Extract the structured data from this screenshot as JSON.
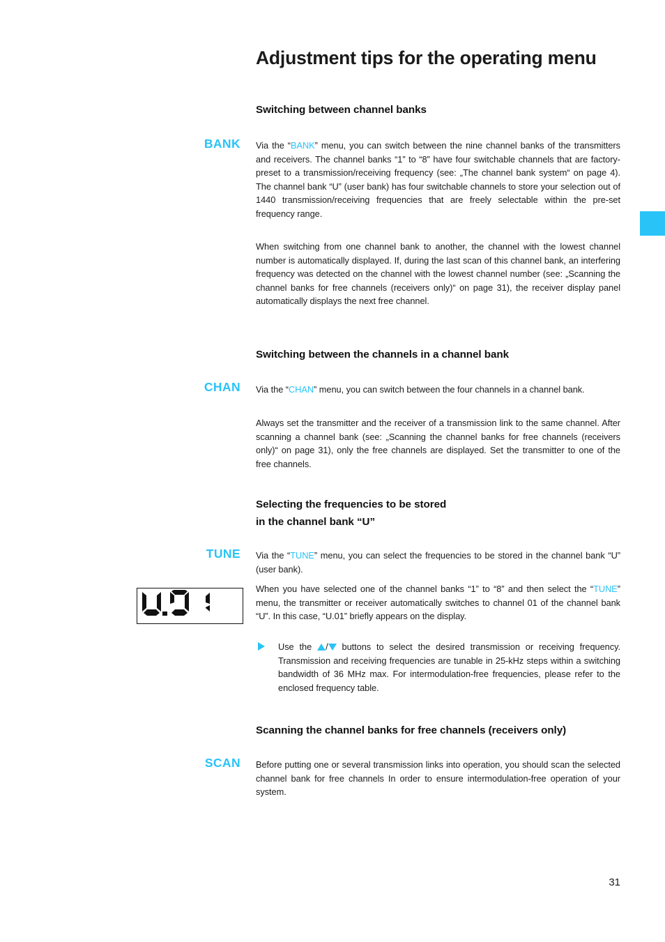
{
  "document": {
    "title": "Adjustment tips for the operating menu",
    "page_number": "31",
    "accent_color": "#29c3f7"
  },
  "chapter_tab": {
    "name": "chapter-marker",
    "color": "#29c3f7"
  },
  "sections": [
    {
      "id": "bank",
      "heading": "Switching between channel banks",
      "menu_label": "BANK",
      "paragraphs": [
        {
          "pre": "Via the “",
          "accent": "BANK",
          "post": "” menu, you can switch between the nine channel banks of the transmitters and receivers. The channel banks “1” to “8” have four switchable channels that are factory-preset to a transmission/receiving frequency (see: „The channel bank system“ on page 4). The channel bank “U” (user bank) has four switchable channels to store your selection out of 1440 transmission/receiving frequencies that are freely selectable within the pre-set frequency range."
        },
        {
          "pre": "",
          "accent": "",
          "post": "When switching from one channel bank to another, the channel with the lowest channel number is automatically displayed. If, during the last scan of this channel bank, an interfering frequency was detected on the channel with the lowest channel number (see: „Scanning the channel banks for free channels (receivers only)“ on page 31), the receiver display panel automatically displays the next free channel."
        }
      ]
    },
    {
      "id": "chan",
      "heading": "Switching between the channels in a channel bank",
      "menu_label": "CHAN",
      "paragraphs": [
        {
          "pre": "Via the “",
          "accent": "CHAN",
          "post": "” menu, you can switch between the four channels in a channel bank."
        },
        {
          "pre": "",
          "accent": "",
          "post": "Always set the transmitter and the receiver of a transmission link to the same channel. After scanning a channel bank (see: „Scanning the channel banks for free channels (receivers only)“ on page 31), only the free channels are displayed. Set the transmitter to one of the free channels."
        }
      ]
    },
    {
      "id": "tune",
      "heading_line1": "Selecting the frequencies to be stored",
      "heading_line2": "in the channel bank “U”",
      "menu_label": "TUNE",
      "paragraphs": [
        {
          "pre": "Via the “",
          "accent": "TUNE",
          "post": "” menu, you can select the frequencies to be stored in the channel bank “U” (user bank)."
        },
        {
          "pre": "When you have selected one of the channel banks “1” to “8” and then select the “",
          "accent": "TUNE",
          "post": "” menu, the transmitter or receiver automatically switches to channel 01 of the channel bank “U”. In this case, “U.01” briefly appears on the display."
        }
      ],
      "bullet": {
        "text_before_icons": "Use the ",
        "text_after_icons": " buttons to select the desired transmission or receiving frequency. Transmission and receiving frequencies are tunable in 25-kHz steps within a switching bandwidth of 36 MHz max. For intermodulation-free frequencies, please refer to the enclosed frequency table.",
        "icon_separator": "/"
      },
      "lcd_display": {
        "value": "U.01",
        "description": "seven-segment LCD showing U.01"
      }
    },
    {
      "id": "scan",
      "heading": "Scanning the channel banks for free channels (receivers only)",
      "menu_label": "SCAN",
      "paragraphs": [
        {
          "pre": "",
          "accent": "",
          "post": "Before putting one or several transmission links into operation, you should scan the selected channel bank for free channels In order to ensure intermodulation-free operation of your system."
        }
      ]
    }
  ]
}
